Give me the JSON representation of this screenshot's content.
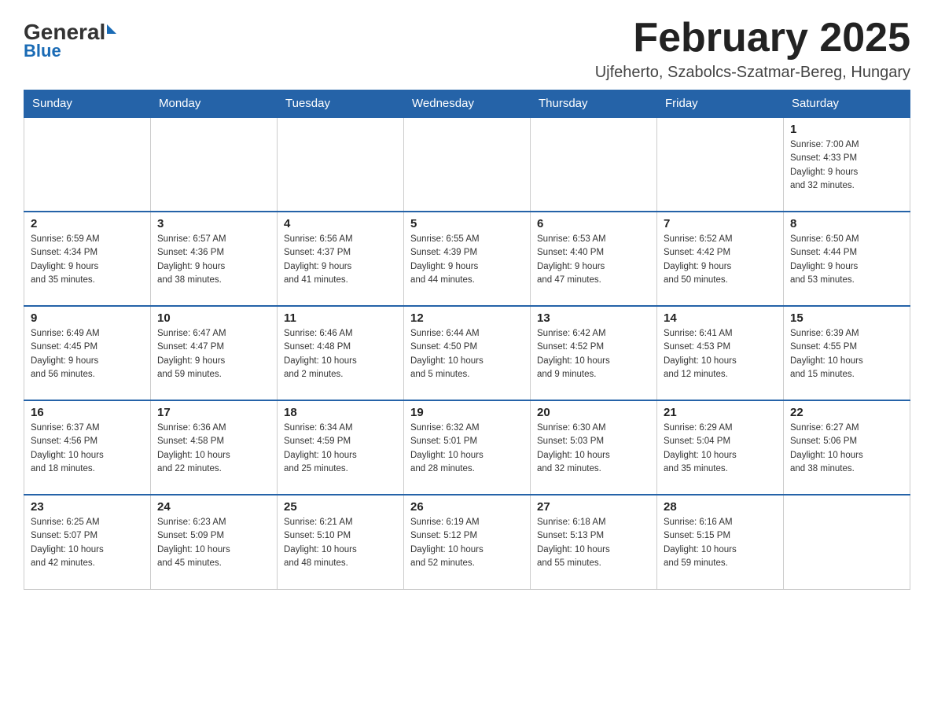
{
  "logo": {
    "general": "General",
    "triangle": "",
    "blue": "Blue"
  },
  "header": {
    "month": "February 2025",
    "location": "Ujfeherto, Szabolcs-Szatmar-Bereg, Hungary"
  },
  "days_of_week": [
    "Sunday",
    "Monday",
    "Tuesday",
    "Wednesday",
    "Thursday",
    "Friday",
    "Saturday"
  ],
  "weeks": [
    [
      {
        "day": "",
        "info": ""
      },
      {
        "day": "",
        "info": ""
      },
      {
        "day": "",
        "info": ""
      },
      {
        "day": "",
        "info": ""
      },
      {
        "day": "",
        "info": ""
      },
      {
        "day": "",
        "info": ""
      },
      {
        "day": "1",
        "info": "Sunrise: 7:00 AM\nSunset: 4:33 PM\nDaylight: 9 hours\nand 32 minutes."
      }
    ],
    [
      {
        "day": "2",
        "info": "Sunrise: 6:59 AM\nSunset: 4:34 PM\nDaylight: 9 hours\nand 35 minutes."
      },
      {
        "day": "3",
        "info": "Sunrise: 6:57 AM\nSunset: 4:36 PM\nDaylight: 9 hours\nand 38 minutes."
      },
      {
        "day": "4",
        "info": "Sunrise: 6:56 AM\nSunset: 4:37 PM\nDaylight: 9 hours\nand 41 minutes."
      },
      {
        "day": "5",
        "info": "Sunrise: 6:55 AM\nSunset: 4:39 PM\nDaylight: 9 hours\nand 44 minutes."
      },
      {
        "day": "6",
        "info": "Sunrise: 6:53 AM\nSunset: 4:40 PM\nDaylight: 9 hours\nand 47 minutes."
      },
      {
        "day": "7",
        "info": "Sunrise: 6:52 AM\nSunset: 4:42 PM\nDaylight: 9 hours\nand 50 minutes."
      },
      {
        "day": "8",
        "info": "Sunrise: 6:50 AM\nSunset: 4:44 PM\nDaylight: 9 hours\nand 53 minutes."
      }
    ],
    [
      {
        "day": "9",
        "info": "Sunrise: 6:49 AM\nSunset: 4:45 PM\nDaylight: 9 hours\nand 56 minutes."
      },
      {
        "day": "10",
        "info": "Sunrise: 6:47 AM\nSunset: 4:47 PM\nDaylight: 9 hours\nand 59 minutes."
      },
      {
        "day": "11",
        "info": "Sunrise: 6:46 AM\nSunset: 4:48 PM\nDaylight: 10 hours\nand 2 minutes."
      },
      {
        "day": "12",
        "info": "Sunrise: 6:44 AM\nSunset: 4:50 PM\nDaylight: 10 hours\nand 5 minutes."
      },
      {
        "day": "13",
        "info": "Sunrise: 6:42 AM\nSunset: 4:52 PM\nDaylight: 10 hours\nand 9 minutes."
      },
      {
        "day": "14",
        "info": "Sunrise: 6:41 AM\nSunset: 4:53 PM\nDaylight: 10 hours\nand 12 minutes."
      },
      {
        "day": "15",
        "info": "Sunrise: 6:39 AM\nSunset: 4:55 PM\nDaylight: 10 hours\nand 15 minutes."
      }
    ],
    [
      {
        "day": "16",
        "info": "Sunrise: 6:37 AM\nSunset: 4:56 PM\nDaylight: 10 hours\nand 18 minutes."
      },
      {
        "day": "17",
        "info": "Sunrise: 6:36 AM\nSunset: 4:58 PM\nDaylight: 10 hours\nand 22 minutes."
      },
      {
        "day": "18",
        "info": "Sunrise: 6:34 AM\nSunset: 4:59 PM\nDaylight: 10 hours\nand 25 minutes."
      },
      {
        "day": "19",
        "info": "Sunrise: 6:32 AM\nSunset: 5:01 PM\nDaylight: 10 hours\nand 28 minutes."
      },
      {
        "day": "20",
        "info": "Sunrise: 6:30 AM\nSunset: 5:03 PM\nDaylight: 10 hours\nand 32 minutes."
      },
      {
        "day": "21",
        "info": "Sunrise: 6:29 AM\nSunset: 5:04 PM\nDaylight: 10 hours\nand 35 minutes."
      },
      {
        "day": "22",
        "info": "Sunrise: 6:27 AM\nSunset: 5:06 PM\nDaylight: 10 hours\nand 38 minutes."
      }
    ],
    [
      {
        "day": "23",
        "info": "Sunrise: 6:25 AM\nSunset: 5:07 PM\nDaylight: 10 hours\nand 42 minutes."
      },
      {
        "day": "24",
        "info": "Sunrise: 6:23 AM\nSunset: 5:09 PM\nDaylight: 10 hours\nand 45 minutes."
      },
      {
        "day": "25",
        "info": "Sunrise: 6:21 AM\nSunset: 5:10 PM\nDaylight: 10 hours\nand 48 minutes."
      },
      {
        "day": "26",
        "info": "Sunrise: 6:19 AM\nSunset: 5:12 PM\nDaylight: 10 hours\nand 52 minutes."
      },
      {
        "day": "27",
        "info": "Sunrise: 6:18 AM\nSunset: 5:13 PM\nDaylight: 10 hours\nand 55 minutes."
      },
      {
        "day": "28",
        "info": "Sunrise: 6:16 AM\nSunset: 5:15 PM\nDaylight: 10 hours\nand 59 minutes."
      },
      {
        "day": "",
        "info": ""
      }
    ]
  ]
}
